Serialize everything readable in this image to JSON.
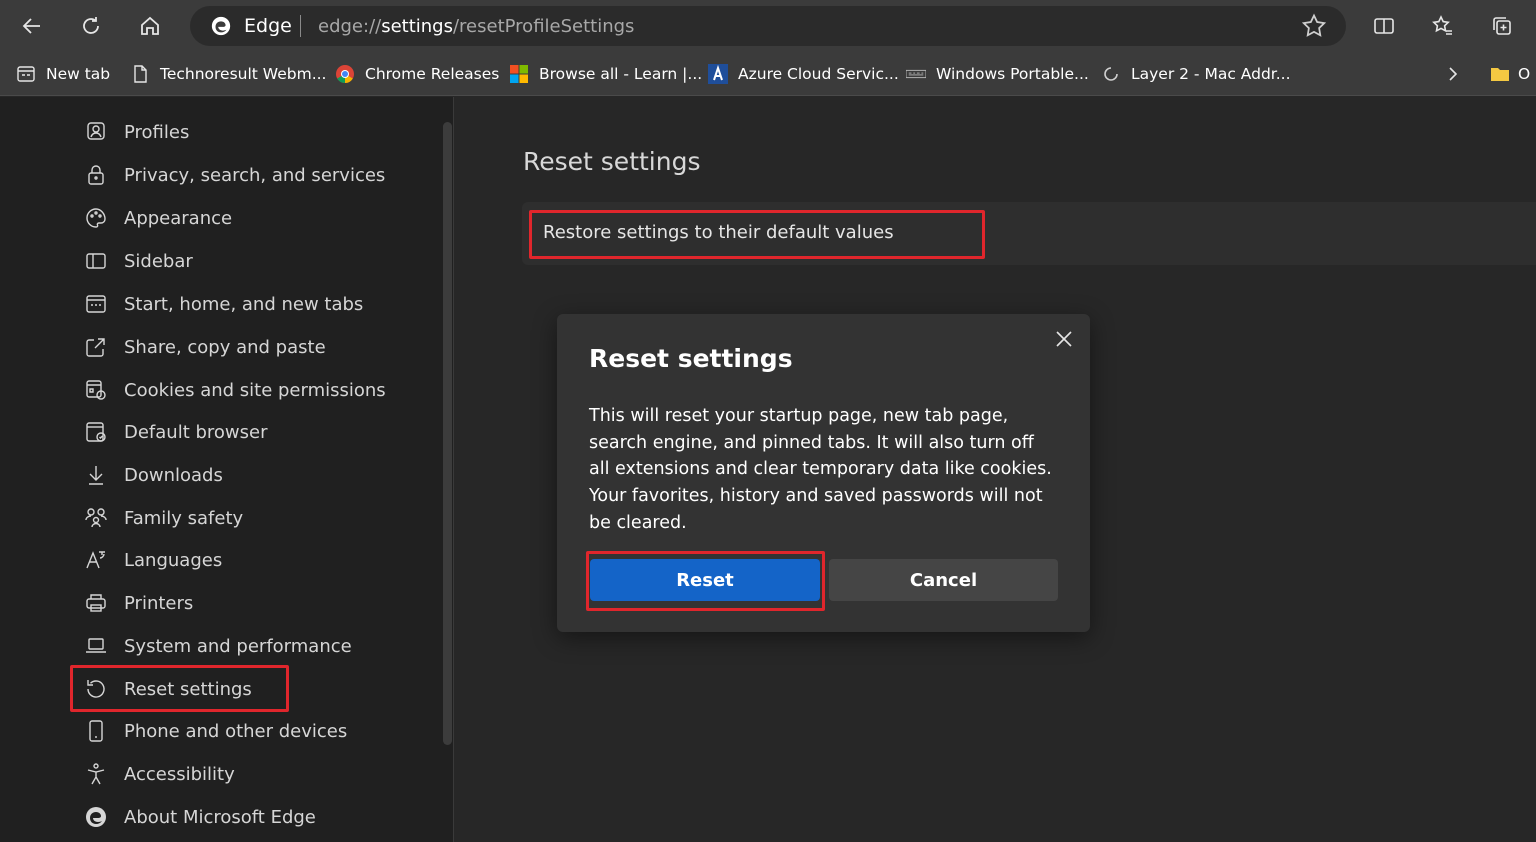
{
  "browser": {
    "brand_name": "Edge",
    "url_prefix": "edge://",
    "url_host": "settings",
    "url_path": "/resetProfileSettings"
  },
  "bookmarks": [
    {
      "label": "New tab",
      "icon": "new-tab-icon"
    },
    {
      "label": "Technoresult Webm...",
      "icon": "page-icon"
    },
    {
      "label": "Chrome Releases",
      "icon": "chrome-icon"
    },
    {
      "label": "Browse all - Learn |...",
      "icon": "microsoft-icon"
    },
    {
      "label": "Azure Cloud Servic...",
      "icon": "azure-icon"
    },
    {
      "label": "Windows Portable...",
      "icon": "site-icon"
    },
    {
      "label": "Layer 2 - Mac Addr...",
      "icon": "loading-icon"
    },
    {
      "label": "O",
      "icon": "folder-icon"
    }
  ],
  "sidebar": {
    "items": [
      {
        "label": "Profiles",
        "icon": "profile-icon"
      },
      {
        "label": "Privacy, search, and services",
        "icon": "lock-icon"
      },
      {
        "label": "Appearance",
        "icon": "palette-icon"
      },
      {
        "label": "Sidebar",
        "icon": "sidebar-icon"
      },
      {
        "label": "Start, home, and new tabs",
        "icon": "home-tab-icon"
      },
      {
        "label": "Share, copy and paste",
        "icon": "share-icon"
      },
      {
        "label": "Cookies and site permissions",
        "icon": "cookie-permissions-icon"
      },
      {
        "label": "Default browser",
        "icon": "default-browser-icon"
      },
      {
        "label": "Downloads",
        "icon": "download-icon"
      },
      {
        "label": "Family safety",
        "icon": "family-icon"
      },
      {
        "label": "Languages",
        "icon": "languages-icon"
      },
      {
        "label": "Printers",
        "icon": "printer-icon"
      },
      {
        "label": "System and performance",
        "icon": "laptop-icon"
      },
      {
        "label": "Reset settings",
        "icon": "reset-icon"
      },
      {
        "label": "Phone and other devices",
        "icon": "phone-icon"
      },
      {
        "label": "Accessibility",
        "icon": "accessibility-icon"
      },
      {
        "label": "About Microsoft Edge",
        "icon": "edge-icon"
      }
    ]
  },
  "main": {
    "title": "Reset settings",
    "restore_label": "Restore settings to their default values"
  },
  "dialog": {
    "title": "Reset settings",
    "body": "This will reset your startup page, new tab page, search engine, and pinned tabs. It will also turn off all extensions and clear temporary data like cookies. Your favorites, history and saved passwords will not be cleared.",
    "reset_label": "Reset",
    "cancel_label": "Cancel"
  },
  "colors": {
    "accent": "#1464c8",
    "highlight": "#e0262c",
    "background": "#272727"
  }
}
